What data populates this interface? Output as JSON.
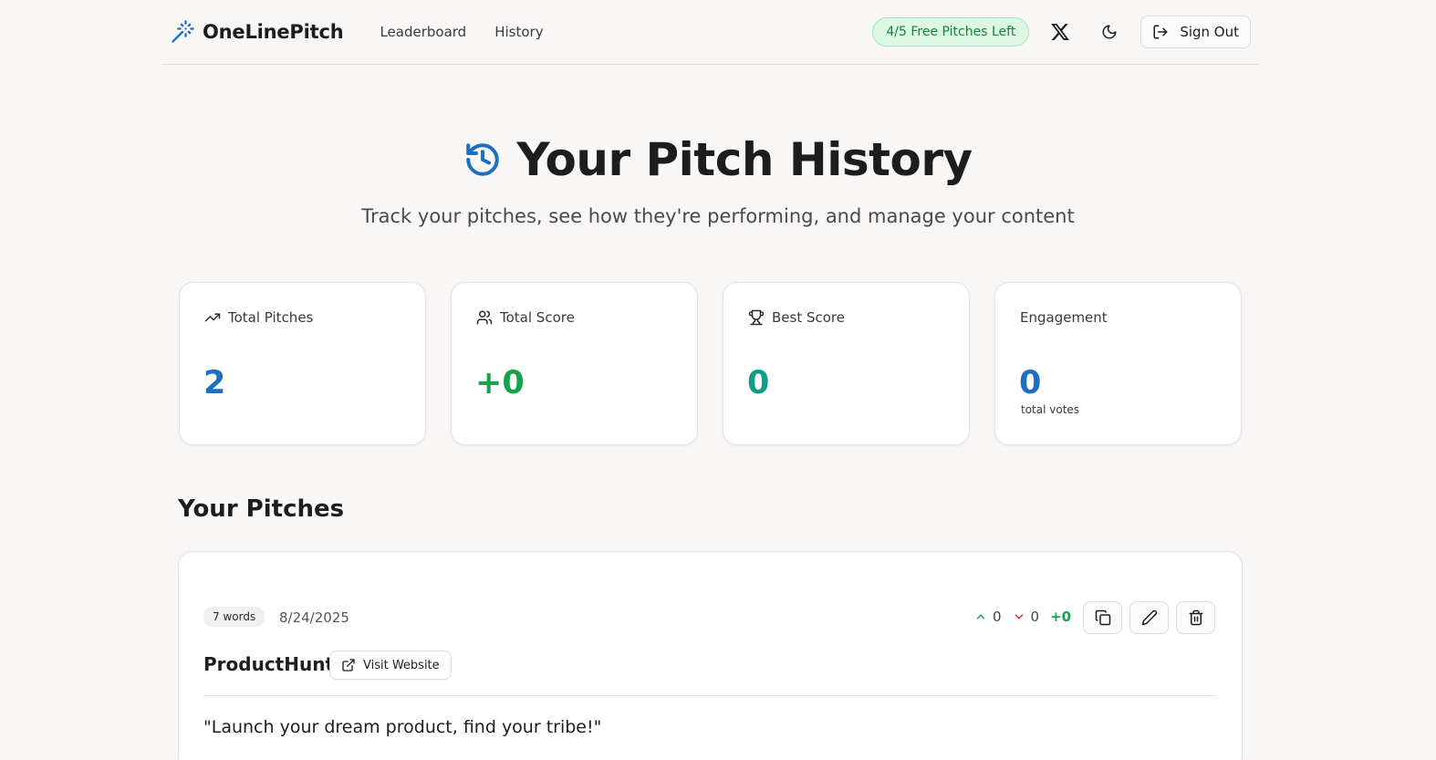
{
  "header": {
    "brand": "OneLinePitch",
    "nav": [
      {
        "label": "Leaderboard"
      },
      {
        "label": "History"
      }
    ],
    "badge": "4/5 Free Pitches Left",
    "sign_out": "Sign Out",
    "icons": [
      "magic-wand-icon",
      "x-logo-icon",
      "moon-icon",
      "log-out-icon"
    ]
  },
  "hero": {
    "title": "Your Pitch History",
    "subtitle": "Track your pitches, see how they're performing, and manage your content",
    "icon": "history-icon"
  },
  "stats": [
    {
      "label": "Total Pitches",
      "value": "2",
      "icon": "trending-up-icon",
      "color": "#1d6fc2"
    },
    {
      "label": "Total Score",
      "value": "+0",
      "icon": "users-icon",
      "color": "#17a34a"
    },
    {
      "label": "Best Score",
      "value": "0",
      "icon": "trophy-icon",
      "color": "#0f9e85"
    },
    {
      "label": "Engagement",
      "value": "0",
      "note": "total votes",
      "color": "#1d6fc2"
    }
  ],
  "pitches_section": {
    "title": "Your Pitches",
    "items": [
      {
        "words": "7 words",
        "date": "8/24/2025",
        "upvotes": "0",
        "downvotes": "0",
        "net": "+0",
        "name": "ProductHunt",
        "visit_label": "Visit Website",
        "text": "\"Launch your dream product, find your tribe!\""
      }
    ]
  },
  "colors": {
    "accent_blue": "#1d6fc2",
    "green": "#17a34a",
    "teal": "#0f9e85",
    "background": "#f9f6f6"
  }
}
